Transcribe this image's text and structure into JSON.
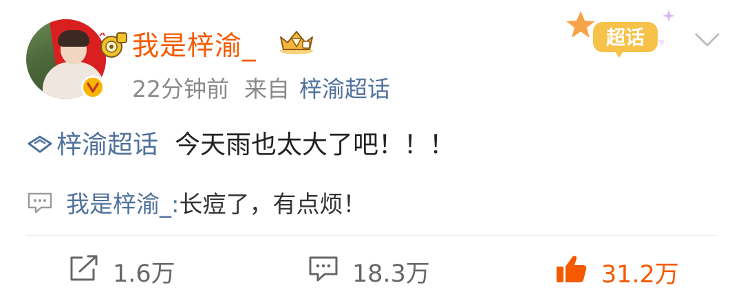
{
  "post": {
    "author": "我是梓渝_",
    "time": "22分钟前",
    "from_label": "来自",
    "source": "梓渝超话",
    "super_topic_badge": "超话",
    "topic": "梓渝超话",
    "text": "今天雨也太大了吧！！！",
    "top_comment": {
      "user": "我是梓渝_",
      "colon": ":",
      "text": "长痘了，有点烦！"
    }
  },
  "actions": {
    "repost_count": "1.6万",
    "comment_count": "18.3万",
    "like_count": "31.2万"
  },
  "colors": {
    "username": "#f55a00",
    "link": "#50729c",
    "like_active": "#f55a00",
    "meta": "#8a8a8a",
    "verified_badge": "#f7b500"
  },
  "icons": {
    "avatar": "avatar",
    "verified": "verified-v-icon",
    "anniversary": "anniversary-badge-icon",
    "member_crown": "member-crown-badge-icon",
    "super_topic": "super-topic-diamond-icon",
    "comment_preview": "comment-bubble-icon",
    "repost": "repost-icon",
    "comment": "comment-icon",
    "like": "thumbs-up-icon",
    "menu": "chevron-down-icon"
  }
}
